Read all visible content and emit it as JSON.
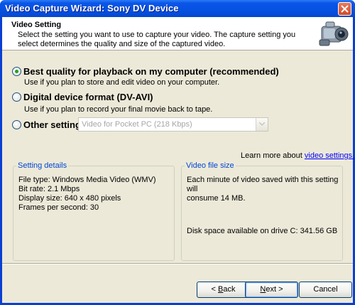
{
  "window": {
    "title": "Video Capture Wizard: Sony DV Device"
  },
  "header": {
    "title": "Video Setting",
    "description": "Select the setting you want to use to capture your video. The capture setting you select determines the quality and size of the captured video."
  },
  "options": [
    {
      "label": "Best quality for playback on my computer (recommended)",
      "description": "Use if you plan to store and edit video on your computer.",
      "selected": true
    },
    {
      "label": "Digital device format (DV-AVI)",
      "description": "Use if you plan to record your final movie back to tape.",
      "selected": false
    },
    {
      "label": "Other settings",
      "selected": false
    }
  ],
  "other_settings_dropdown": {
    "value": "Video for Pocket PC (218 Kbps)"
  },
  "learn_more": {
    "text": "Learn more about ",
    "link": "video settings."
  },
  "setting_details": {
    "title": "Setting details",
    "lines": [
      "File type: Windows Media Video (WMV)",
      "Bit rate: 2.1 Mbps",
      "Display size: 640 x 480 pixels",
      "Frames per second: 30"
    ]
  },
  "video_file_size": {
    "title": "Video file size",
    "line1": "Each minute of video saved with this setting  will",
    "line2": "consume 14 MB.",
    "disk_space": "Disk space available on drive C: 341.56 GB"
  },
  "buttons": {
    "back": {
      "arrow": "<",
      "mnemonic": "B",
      "rest": "ack"
    },
    "next": {
      "mnemonic": "N",
      "rest": "ext",
      "arrow": ">"
    },
    "cancel": "Cancel"
  },
  "colors": {
    "titlebar": "#0551e1",
    "dialog_bg": "#ece9d8",
    "group_title": "#0046d5",
    "link": "#0000ff"
  },
  "icons": {
    "close": "close-icon",
    "camera": "video-camera-icon",
    "dropdown": "chevron-down-icon"
  }
}
